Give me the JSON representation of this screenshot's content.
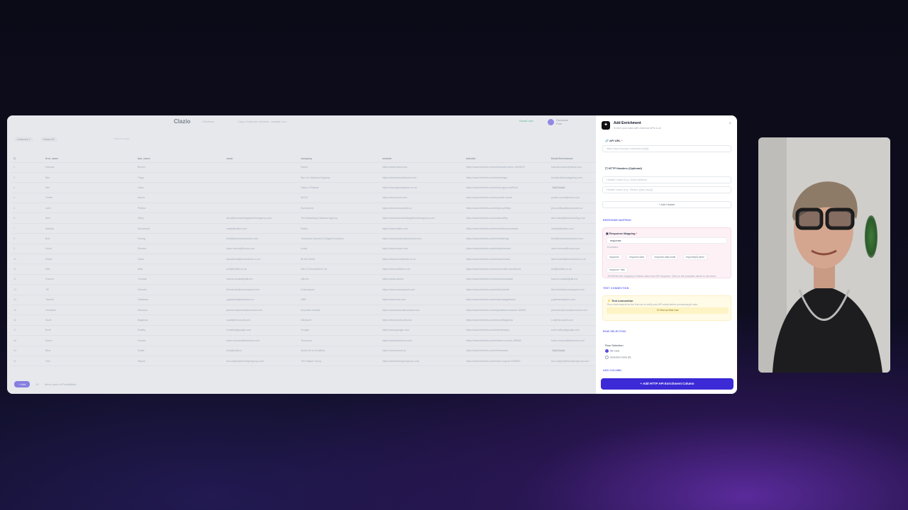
{
  "app": {
    "logo": "Clazio",
    "breadcrumb_1": "Guidance",
    "breadcrumb_2": "Copy of sample contacts - sample con...",
    "status": "Saved now",
    "workspace_name": "Guidance",
    "workspace_sub": "Free"
  },
  "toolbar": {
    "columns_label": "Columns",
    "columns_count": "7",
    "rows_label": "Rows",
    "rows_count": "20",
    "search_placeholder": "Search rows"
  },
  "table": {
    "headers": [
      "first_name",
      "last_name",
      "email",
      "company",
      "website",
      "linkedin",
      "Email Enrichment"
    ],
    "rows": [
      [
        "1",
        "Hannah",
        "Burton",
        "",
        "Rabot",
        "https://www.rabot.com",
        "https://www.linkedin.com/in/hannah-burton-3409875",
        "hannah.burton@rabot.com"
      ],
      [
        "2",
        "Ben",
        "Trapp",
        "",
        "Ben for Outbound Agency",
        "https://www.benoutbound.com",
        "https://www.linkedin.com/in/bentrapp",
        "ben@outboundagency.com"
      ],
      [
        "3",
        "Mel",
        "Glynn",
        "",
        "Glynn & Partner",
        "https://www.glynnpartner.co.uk",
        "https://www.linkedin.com/in/mel-glynn-4d91a3",
        "Not Found"
      ],
      [
        "4",
        "Yvette",
        "Moore",
        "",
        "MOOT",
        "https://www.moot.com",
        "https://www.linkedin.com/in/yvette-moore",
        "yvette.moore@moot.com"
      ],
      [
        "5",
        "John",
        "Phillips",
        "",
        "Sunnyclerk",
        "https://www.sunnyclerk.co",
        "https://www.linkedin.com/in/john-phillips",
        "john.phillips@sunnyclerk.co"
      ],
      [
        "6",
        "Alex",
        "Wiley",
        "alex@themarketingdetectiveagency.com",
        "The Marketing Detective Agency",
        "https://www.themarketingdetectiveagency.com",
        "https://www.linkedin.com/in/alexwiley",
        "alex.wiley@themarketing.com"
      ],
      [
        "7",
        "Matilda",
        "Woodward",
        "matty@rakku.com",
        "Rakku",
        "https://www.rakku.com",
        "https://www.linkedin.com/in/matilda-woodward",
        "matilda@rakku.com"
      ],
      [
        "8",
        "Brie",
        "Facing",
        "brie@tomorrowconnect.com",
        "Tomorrow Connect & Digital Solutions",
        "https://www.tomorrowconnect.com",
        "https://www.linkedin.com/in/briefacing",
        "brie@tomorrowconnect.com"
      ],
      [
        "9",
        "Lizzie",
        "Reeves",
        "lizzie.reeves@icoslx.com",
        "Icoslx",
        "https://www.icoslx.com",
        "https://www.linkedin.com/in/lizziereeves",
        "lizzie.reeves@icoslx.com"
      ],
      [
        "10",
        "David",
        "Hand",
        "davidhand@brookstreet.co.uk",
        "Brook Street",
        "https://www.brookstreet.co.uk",
        "https://www.linkedin.com/in/david-hand",
        "david.hand@brookstreet.co.uk"
      ],
      [
        "11",
        "Neil",
        "Mills",
        "neil@millsfd.co.uk",
        "MILLS Recruitment Ltd",
        "https://www.millsfd.co.uk",
        "https://www.linkedin.com/in/neil-mills-recruitment",
        "neil@millsfd.co.uk"
      ],
      [
        "12",
        "Francis",
        "Tunstall",
        "francis.tunstall@ultra.io",
        "Ultra.io",
        "https://www.ultra.io",
        "https://www.linkedin.com/in/francistunstall",
        "francis.tunstall@ultra.io"
      ],
      [
        "13",
        "Till",
        "Schmitz",
        "till.schmitz@cosmosport.com",
        "Cosmosport",
        "https://www.cosmosport.com",
        "https://www.linkedin.com/in/till-schmitz",
        "till.schmitz@cosmosport.com"
      ],
      [
        "14",
        "Yasmin",
        "Gabbana",
        "y.gabbana@ubmarco.co",
        "UBS",
        "https://www.ubs.com",
        "https://www.linkedin.com/in/yasmingabbana",
        "y.gabbana@ubs.com"
      ],
      [
        "15",
        "Jonathan",
        "Wessner",
        "jwessner@innovateconsult.com",
        "Innovate Consult",
        "https://www.innovateconsult.com",
        "https://www.linkedin.com/in/jonathan-wessner-6f3d3f",
        "jwessner@innovateconsult.com"
      ],
      [
        "16",
        "Scott",
        "Bagshaw",
        "scott@microsoft.com",
        "Microsoft",
        "https://www.microsoft.com",
        "https://www.linkedin.com/in/scottbagshaw",
        "s.b@microsoft.com"
      ],
      [
        "17",
        "Brett",
        "Radley",
        "b.radley@google.com",
        "Google",
        "https://www.google.com",
        "https://www.linkedin.com/in/brettradley",
        "brett.radley@google.com"
      ],
      [
        "18",
        "Karen",
        "Hoover",
        "karen.hoover@tesonova.com",
        "Tesonova",
        "https://www.tesonova.com",
        "https://www.linkedin.com/in/karen-hoover-3f9828",
        "karen.hoover@tesonova.com"
      ],
      [
        "19",
        "Bina",
        "Radia",
        "bina@radia.io",
        "Axiom AI for Ambition",
        "https://www.axiom.ai",
        "https://www.linkedin.com/in/binaradia",
        "Not Found"
      ],
      [
        "20",
        "Tom",
        "Wayne",
        "tom.wayne@thewaynegroup.com",
        "The Wayne Group",
        "https://www.thewaynegroup.com",
        "https://www.linkedin.com/in/tom-wayne-3409857",
        "tom.wayne@thewaynegroup.com"
      ]
    ]
  },
  "sheet_footer": {
    "add_label": "+ Add",
    "count": "10",
    "info": "Items used of Flexibilities"
  },
  "panel": {
    "title": "Add Enrichment",
    "subtitle": "Enrich your data with external APIs & AI",
    "close": "×",
    "api_url_label": "API URL",
    "api_url_placeholder": "https://api.example.com/users/{{id}}",
    "headers_label": "HTTP Headers (Optional)",
    "header_name_placeholder": "Header name (e.g., Authorization)",
    "header_value_placeholder": "Header value (e.g., Bearer {{api_key}})",
    "add_header": "+ Add Header",
    "section_response": "RESPONSE MAPPING",
    "response_label": "Response Mapping",
    "response_value": "response",
    "examples_label": "Examples:",
    "examples": [
      "response",
      "response.data",
      "response.data.email",
      "response[0].name",
      "response.*.title"
    ],
    "response_hint": "JSONPath-like mapping to extract value from API response. Click on the examples above to use them.",
    "section_test": "TEST CONNECTION",
    "test_label": "Test connection",
    "test_hint": "Run a test request on the first row to verify your API setup before processing all rows.",
    "test_button": "Test on first row",
    "section_rows": "ROW SELECTION",
    "rows_label": "Row Selection",
    "rows_opt_all": "All rows",
    "rows_opt_selected": "Selected rows (0)",
    "section_column": "ADD COLUMN",
    "cta": "+ Add HTTP API Enrichment Column"
  }
}
